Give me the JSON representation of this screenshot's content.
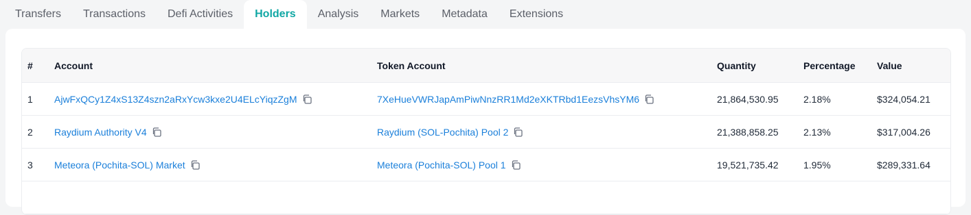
{
  "tabs": [
    {
      "label": "Transfers"
    },
    {
      "label": "Transactions"
    },
    {
      "label": "Defi Activities"
    },
    {
      "label": "Holders"
    },
    {
      "label": "Analysis"
    },
    {
      "label": "Markets"
    },
    {
      "label": "Metadata"
    },
    {
      "label": "Extensions"
    }
  ],
  "active_tab": "Holders",
  "table": {
    "headers": {
      "index": "#",
      "account": "Account",
      "token_account": "Token Account",
      "quantity": "Quantity",
      "percentage": "Percentage",
      "value": "Value"
    },
    "rows": [
      {
        "index": "1",
        "account": "AjwFxQCy1Z4xS13Z4szn2aRxYcw3kxe2U4ELcYiqzZgM",
        "token_account": "7XeHueVWRJapAmPiwNnzRR1Md2eXKTRbd1EezsVhsYM6",
        "quantity": "21,864,530.95",
        "percentage": "2.18%",
        "value": "$324,054.21"
      },
      {
        "index": "2",
        "account": "Raydium Authority V4",
        "token_account": "Raydium (SOL-Pochita) Pool 2",
        "quantity": "21,388,858.25",
        "percentage": "2.13%",
        "value": "$317,004.26"
      },
      {
        "index": "3",
        "account": "Meteora (Pochita-SOL) Market",
        "token_account": "Meteora (Pochita-SOL) Pool 1",
        "quantity": "19,521,735.42",
        "percentage": "1.95%",
        "value": "$289,331.64"
      }
    ]
  },
  "icons": {
    "copy": "copy-icon"
  },
  "colors": {
    "active_tab": "#10a7a4",
    "link": "#1a7fda",
    "page_bg": "#f4f5f6",
    "panel_bg": "#ffffff",
    "header_bg": "#f7f7f8"
  }
}
